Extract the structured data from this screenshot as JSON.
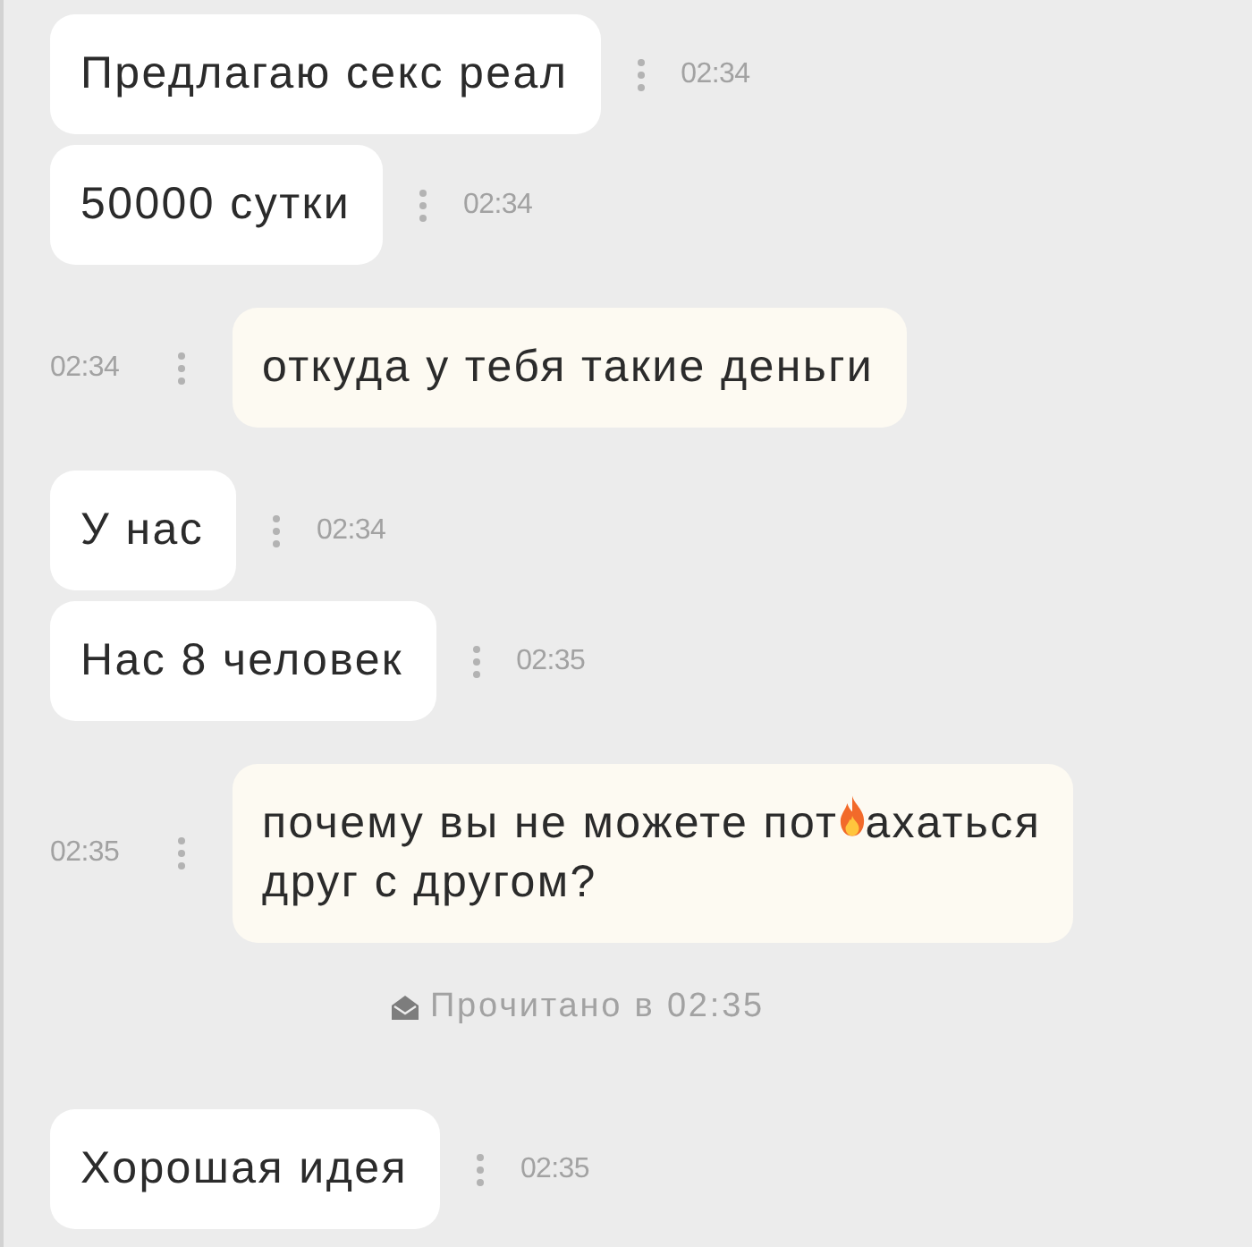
{
  "messages": [
    {
      "kind": "message",
      "outgoing": false,
      "time": "02:34",
      "lines": [
        [
          {
            "kind": "text",
            "text": "Предлагаю секс реал"
          }
        ]
      ]
    },
    {
      "kind": "message",
      "outgoing": false,
      "time": "02:34",
      "lines": [
        [
          {
            "kind": "text",
            "text": "50000 сутки"
          }
        ]
      ]
    },
    {
      "kind": "message",
      "outgoing": true,
      "time": "02:34",
      "lines": [
        [
          {
            "kind": "text",
            "text": "откуда у тебя такие деньги"
          }
        ]
      ]
    },
    {
      "kind": "message",
      "outgoing": false,
      "time": "02:34",
      "lines": [
        [
          {
            "kind": "text",
            "text": "У нас"
          }
        ]
      ]
    },
    {
      "kind": "message",
      "outgoing": false,
      "time": "02:35",
      "lines": [
        [
          {
            "kind": "text",
            "text": "Нас 8 человек"
          }
        ]
      ]
    },
    {
      "kind": "message",
      "outgoing": true,
      "time": "02:35",
      "lines": [
        [
          {
            "kind": "text",
            "text": "почему вы не можете пот"
          },
          {
            "kind": "emoji"
          },
          {
            "kind": "text",
            "text": "ахаться"
          }
        ],
        [
          {
            "kind": "text",
            "text": "друг с другом?"
          }
        ]
      ]
    },
    {
      "kind": "receipt",
      "text": "Прочитано в 02:35"
    },
    {
      "kind": "message",
      "outgoing": false,
      "time": "02:35",
      "lines": [
        [
          {
            "kind": "text",
            "text": "Хорошая идея"
          }
        ]
      ]
    }
  ]
}
